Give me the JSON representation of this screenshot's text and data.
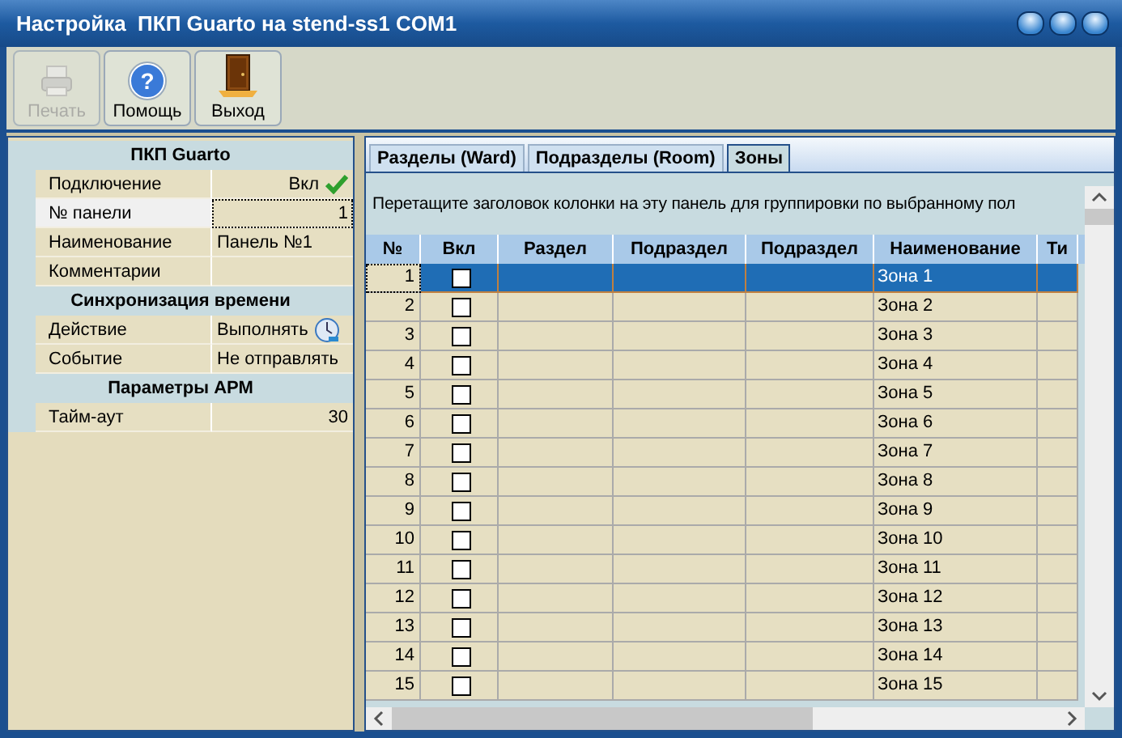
{
  "window": {
    "title": "Настройка  ПКП Guarto на stend-ss1 COM1"
  },
  "toolbar": [
    {
      "label": "Печать",
      "kind": "print",
      "disabled": true
    },
    {
      "label": "Помощь",
      "kind": "help",
      "glyph": "?",
      "disabled": false
    },
    {
      "label": "Выход",
      "kind": "exit",
      "disabled": false
    }
  ],
  "properties": [
    {
      "section": "ПКП Guarto",
      "rows": [
        {
          "label": "Подключение",
          "value": "Вкл",
          "selected": false
        },
        {
          "label": "№ панели",
          "value": "1",
          "selected": true
        },
        {
          "label": "Наименование",
          "value": "Панель №1",
          "selected": false
        },
        {
          "label": "Комментарии",
          "selected": false
        }
      ]
    },
    {
      "section": "Синхронизация времени",
      "rows": [
        {
          "label": "Действие",
          "value": "Выполнять",
          "selected": false
        },
        {
          "label": "Событие",
          "value": "Не отправлять",
          "selected": false
        }
      ]
    },
    {
      "section": "Параметры АРМ",
      "rows": [
        {
          "label": "Тайм-аут",
          "value": "30",
          "selected": false
        }
      ]
    }
  ],
  "tabs": [
    {
      "label": "Разделы (Ward)",
      "selected": false
    },
    {
      "label": "Подразделы (Room)",
      "selected": false
    },
    {
      "label": "Зоны",
      "selected": true
    }
  ],
  "group_hint": "Перетащите заголовок колонки на эту панель для группировки по выбранному пол",
  "table": {
    "columns": [
      "№",
      "Вкл",
      "Раздел",
      "Подраздел",
      "Подраздел",
      "Наименование",
      "Ти"
    ],
    "rows": [
      {
        "number": "1",
        "checked": false,
        "name": "Зона 1",
        "selected": true
      },
      {
        "number": "2",
        "checked": false,
        "name": "Зона 2",
        "selected": false
      },
      {
        "number": "3",
        "checked": false,
        "name": "Зона 3",
        "selected": false
      },
      {
        "number": "4",
        "checked": false,
        "name": "Зона 4",
        "selected": false
      },
      {
        "number": "5",
        "checked": false,
        "name": "Зона 5",
        "selected": false
      },
      {
        "number": "6",
        "checked": false,
        "name": "Зона 6",
        "selected": false
      },
      {
        "number": "7",
        "checked": false,
        "name": "Зона 7",
        "selected": false
      },
      {
        "number": "8",
        "checked": false,
        "name": "Зона 8",
        "selected": false
      },
      {
        "number": "9",
        "checked": false,
        "name": "Зона 9",
        "selected": false
      },
      {
        "number": "10",
        "checked": false,
        "name": "Зона 10",
        "selected": false
      },
      {
        "number": "11",
        "checked": false,
        "name": "Зона 11",
        "selected": false
      },
      {
        "number": "12",
        "checked": false,
        "name": "Зона 12",
        "selected": false
      },
      {
        "number": "13",
        "checked": false,
        "name": "Зона 13",
        "selected": false
      },
      {
        "number": "14",
        "checked": false,
        "name": "Зона 14",
        "selected": false
      },
      {
        "number": "15",
        "checked": false,
        "name": "Зона 15",
        "selected": false
      }
    ]
  }
}
